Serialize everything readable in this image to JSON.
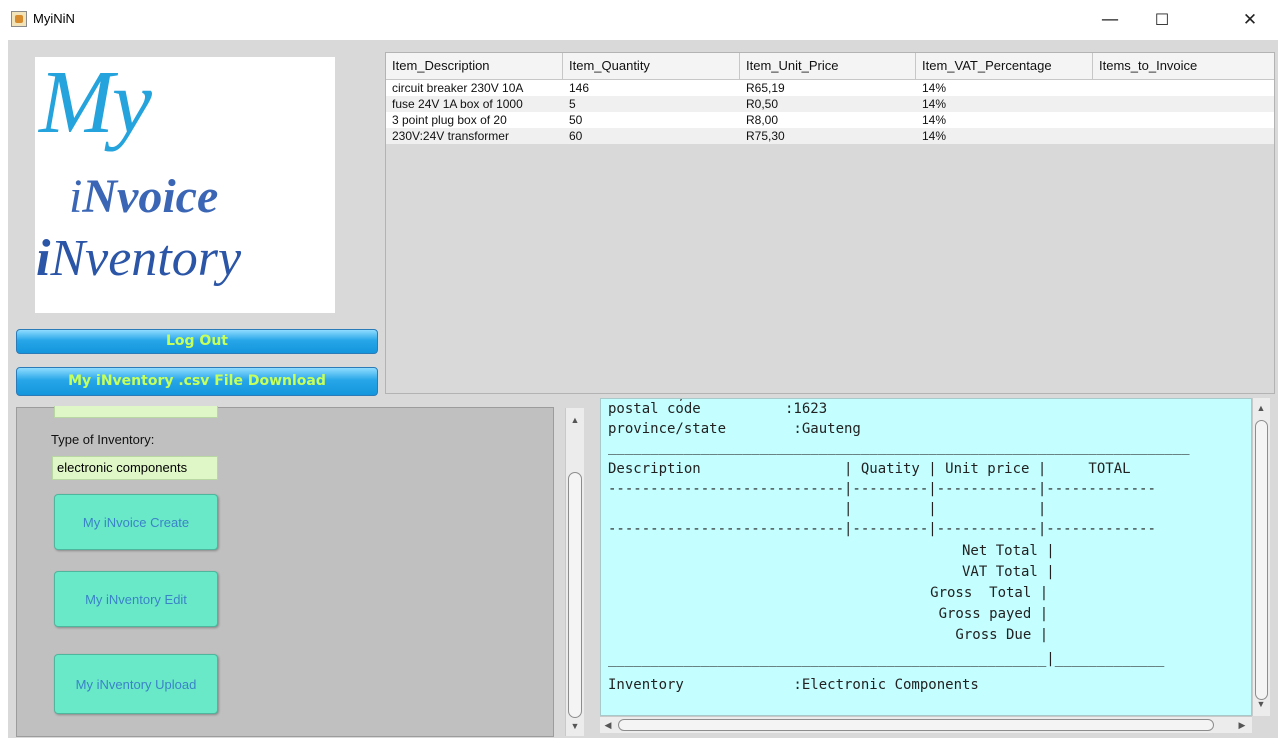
{
  "window": {
    "title": "MyiNiN",
    "controls": [
      "—",
      "☐",
      "✕"
    ]
  },
  "logo": {
    "line1": "My",
    "line2_i": "i",
    "line2_rest": "Nvoice",
    "line3_i": "i",
    "line3_rest": "Nventory"
  },
  "buttons": {
    "logout": "Log Out",
    "download": "My iNventory .csv File Download",
    "invoice_create": "My iNvoice Create",
    "inventory_edit": "My iNventory Edit",
    "inventory_upload": "My iNventory Upload"
  },
  "table": {
    "columns": [
      "Item_Description",
      "Item_Quantity",
      "Item_Unit_Price",
      "Item_VAT_Percentage",
      "Items_to_Invoice"
    ],
    "rows": [
      [
        "circuit breaker 230V 10A",
        "146",
        "R65,19",
        "14%",
        ""
      ],
      [
        "fuse  24V 1A box of 1000",
        "5",
        "R0,50",
        "14%",
        ""
      ],
      [
        "3 point plug box of 20",
        "50",
        "R8,00",
        "14%",
        ""
      ],
      [
        "230V:24V transformer",
        "60",
        "R75,30",
        "14%",
        ""
      ]
    ]
  },
  "left_form": {
    "type_label": "Type of Inventory:",
    "type_value": "electronic components"
  },
  "invoice_text": {
    "line_postal": "postal code          :1623",
    "line_province": "province/state        :Gauteng",
    "line_rule_top": "_____________________________________________________________________",
    "line_headers": "Description                 | Quatity | Unit price |     TOTAL",
    "line_dash1": "----------------------------|---------|------------|-------------",
    "line_blank": "                            |         |            |",
    "line_dash2": "----------------------------|---------|------------|-------------",
    "line_net": "                                          Net Total |",
    "line_vat": "                                          VAT Total |",
    "line_gross": "                                        Gross  Total |",
    "line_payed": "                                         Gross payed |",
    "line_due": "                                           Gross Due |",
    "line_rule_bottom": "____________________________________________________|_____________",
    "line_inventory": "Inventory             :Electronic Components"
  },
  "colors": {
    "window_bg": "#d9d9d9",
    "blue_button": "#27a6e8",
    "blue_button_text": "#c6ff5a",
    "teal_button": "#6ae9c8",
    "invoice_bg": "#c4feff",
    "field_bg": "#dff7c6"
  }
}
